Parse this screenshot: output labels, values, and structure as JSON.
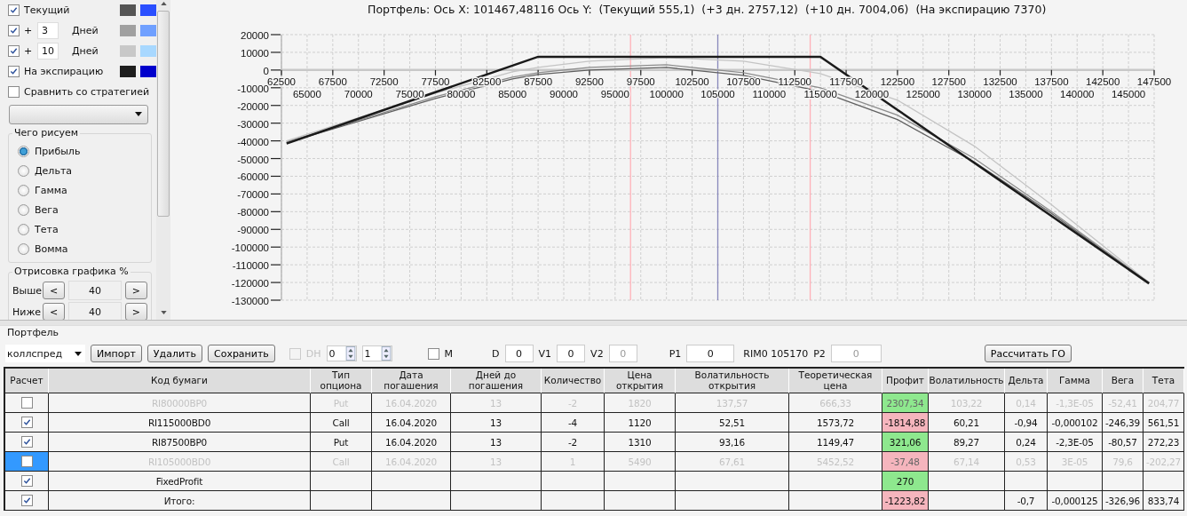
{
  "display_panel": {
    "series_rows": [
      {
        "kind": "current",
        "label": "Текущий",
        "checked": true,
        "swatches": [
          {
            "color": "#555555"
          },
          {
            "color": "#2a4fff"
          }
        ]
      },
      {
        "kind": "days",
        "prefix": "+",
        "value": "3",
        "unit": "Дней",
        "checked": true,
        "swatches": [
          {
            "color": "#a0a0a0"
          },
          {
            "color": "#70a0ff"
          }
        ]
      },
      {
        "kind": "days",
        "prefix": "+",
        "value": "10",
        "unit": "Дней",
        "checked": true,
        "swatches": [
          {
            "color": "#c8c8c8"
          },
          {
            "color": "#a8d8ff"
          }
        ]
      },
      {
        "kind": "current",
        "label": "На экспирацию",
        "checked": true,
        "swatches": [
          {
            "color": "#1e1e1e"
          },
          {
            "color": "#0000cc"
          }
        ]
      }
    ],
    "compare": {
      "label": "Сравнить со стратегией",
      "checked": false
    },
    "plot_group": {
      "title": "Чего рисуем",
      "options": [
        {
          "label": "Прибыль",
          "selected": true
        },
        {
          "label": "Дельта",
          "selected": false
        },
        {
          "label": "Гамма",
          "selected": false
        },
        {
          "label": "Вега",
          "selected": false
        },
        {
          "label": "Тета",
          "selected": false
        },
        {
          "label": "Вомма",
          "selected": false
        }
      ]
    },
    "range_group": {
      "title": "Отрисовка графика %",
      "rows": [
        {
          "label": "Выше",
          "prev": "<",
          "value": "40",
          "next": ">"
        },
        {
          "label": "Ниже",
          "prev": "<",
          "value": "40",
          "next": ">"
        }
      ]
    }
  },
  "chart": {
    "chart_data": {
      "type": "line",
      "grid": true,
      "title": "Портфель: Ось X: 101467,48116 Ось Y:  (Текущий 555,1)  (+3 дн. 2757,12)  (+10 дн. 7004,06)  (На экспирацию 7370)",
      "x": [
        63000,
        70000,
        77500,
        85000,
        87500,
        92500,
        100000,
        107500,
        115000,
        122500,
        130000,
        137500,
        147000
      ],
      "series": [
        {
          "color": "#606060",
          "values": [
            -41000,
            -29000,
            -16000,
            -5000,
            -2500,
            0,
            1500,
            -3000,
            -12000,
            -28000,
            -52000,
            -81000,
            -120500
          ]
        },
        {
          "color": "#8c8c8c",
          "values": [
            -40500,
            -28500,
            -15000,
            -4000,
            -1500,
            1500,
            3000,
            -1500,
            -10000,
            -25500,
            -50000,
            -80000,
            -120000
          ]
        },
        {
          "color": "#c4c4c4",
          "values": [
            -40000,
            -27000,
            -13000,
            -1000,
            1500,
            5000,
            7000,
            5000,
            -2000,
            -17000,
            -43000,
            -76000,
            -120000
          ]
        },
        {
          "color": "#1a1a1a",
          "values": [
            -41500,
            -27500,
            -12500,
            2500,
            7500,
            7500,
            7500,
            7500,
            7500,
            -22500,
            -52500,
            -82500,
            -120500
          ]
        }
      ],
      "xlim": [
        62500,
        147500
      ],
      "ylim": [
        -130000,
        20000
      ],
      "xticks": [
        62500,
        67500,
        72500,
        77500,
        82500,
        87500,
        92500,
        97500,
        102500,
        107500,
        112500,
        117500,
        122500,
        127500,
        132500,
        137500,
        142500,
        147500
      ],
      "yticks": [
        20000,
        10000,
        0,
        -10000,
        -20000,
        -30000,
        -40000,
        -50000,
        -60000,
        -70000,
        -80000,
        -90000,
        -100000,
        -110000,
        -120000,
        -130000
      ],
      "ref_lines": [
        {
          "axis": "x",
          "value": 96500,
          "color": "#ffb0b8"
        },
        {
          "axis": "x",
          "value": 105000,
          "color": "#8888bb"
        },
        {
          "axis": "x",
          "value": 114000,
          "color": "#ffb0b8"
        }
      ],
      "annotations": [
        "65000",
        "70000",
        "75000",
        "80000",
        "85000",
        "90000",
        "95000",
        "100000",
        "105000",
        "110000",
        "115000",
        "120000",
        "125000",
        "130000",
        "135000",
        "140000",
        "145000"
      ]
    }
  },
  "portfolio": {
    "title": "Портфель",
    "strategy": "коллспред",
    "buttons": [
      "Импорт",
      "Удалить",
      "Сохранить"
    ],
    "dh": {
      "label": "DH",
      "checked": false,
      "disabled": true
    },
    "spinners": [
      "0",
      "1"
    ],
    "m": {
      "label": "M",
      "checked": false
    },
    "fields": [
      {
        "label": "D",
        "value": "0",
        "disabled": false
      },
      {
        "label": "V1",
        "value": "0",
        "disabled": false
      },
      {
        "label": "V2",
        "value": "0",
        "disabled": true
      },
      {
        "label": "P1",
        "value": "0",
        "disabled": false
      }
    ],
    "price_label": "RIM0 105170",
    "p2": {
      "label": "P2",
      "value": "0",
      "disabled": true
    },
    "calc_button": "Рассчитать ГО",
    "check_column": "Расчет",
    "columns": [
      "Код бумаги",
      "Тип опциона",
      "Дата погашения",
      "Дней до погашения",
      "Количество",
      "Цена открытия",
      "Волатильность открытия",
      "Теоретическая цена",
      "Профит",
      "Волатильность",
      "Дельта",
      "Гамма",
      "Вега",
      "Тета"
    ],
    "rows": [
      {
        "checked": false,
        "disabled": true,
        "selected": false,
        "color": "#8ee88e",
        "cells": [
          "RI80000BP0",
          "Put",
          "16.04.2020",
          "13",
          "-2",
          "1820",
          "137,57",
          "666,33",
          "2307,34",
          "103,22",
          "0,14",
          "-1,3E-05",
          "-52,41",
          "204,77"
        ]
      },
      {
        "checked": true,
        "disabled": false,
        "selected": false,
        "color": "#f5b5bd",
        "cells": [
          "RI115000BD0",
          "Call",
          "16.04.2020",
          "13",
          "-4",
          "1120",
          "52,51",
          "1573,72",
          "-1814,88",
          "60,21",
          "-0,94",
          "-0,000102",
          "-246,39",
          "561,51"
        ]
      },
      {
        "checked": true,
        "disabled": false,
        "selected": false,
        "color": "#8ee88e",
        "cells": [
          "RI87500BP0",
          "Put",
          "16.04.2020",
          "13",
          "-2",
          "1310",
          "93,16",
          "1149,47",
          "321,06",
          "89,27",
          "0,24",
          "-2,3E-05",
          "-80,57",
          "272,23"
        ]
      },
      {
        "checked": false,
        "disabled": true,
        "selected": true,
        "color": "#f5b5bd",
        "cells": [
          "RI105000BD0",
          "Call",
          "16.04.2020",
          "13",
          "1",
          "5490",
          "67,61",
          "5452,52",
          "-37,48",
          "67,14",
          "0,53",
          "3E-05",
          "79,6",
          "-202,27"
        ]
      },
      {
        "checked": true,
        "disabled": false,
        "selected": false,
        "color": "#8ee88e",
        "cells": [
          "FixedProfit",
          null,
          null,
          null,
          null,
          null,
          null,
          null,
          "270",
          null,
          null,
          null,
          null,
          null
        ]
      },
      {
        "checked": true,
        "disabled": false,
        "selected": false,
        "color": "#f5b5bd",
        "cells": [
          "Итого:",
          null,
          null,
          null,
          null,
          null,
          null,
          null,
          "-1223,82",
          null,
          "-0,7",
          "-0,000125",
          "-326,96",
          "833,74"
        ]
      }
    ]
  }
}
